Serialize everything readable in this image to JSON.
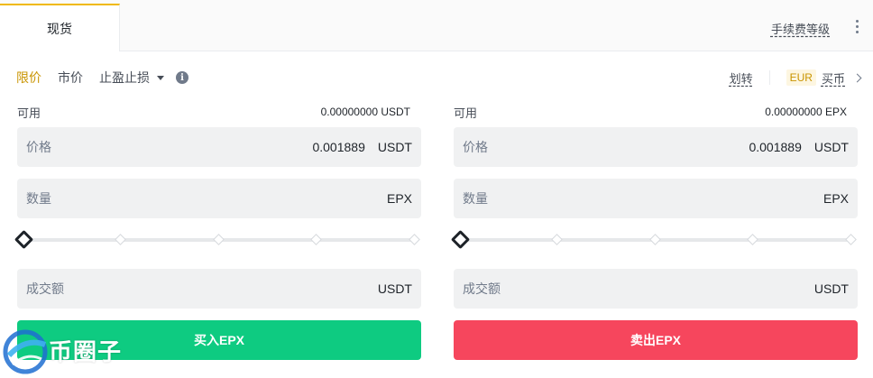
{
  "tabs": {
    "spot": "现货"
  },
  "header": {
    "fee_level": "手续费等级",
    "more_icon": "more-vertical-icon"
  },
  "order_types": {
    "limit": "限价",
    "market": "市价",
    "stop": "止盈止损",
    "info_icon": "info-icon"
  },
  "links": {
    "transfer": "划转",
    "currency": "EUR",
    "buy_crypto": "买币"
  },
  "buy": {
    "available_label": "可用",
    "available_value": "0.00000000 USDT",
    "price_label": "价格",
    "price_value": "0.001889",
    "price_unit": "USDT",
    "amount_label": "数量",
    "amount_unit": "EPX",
    "slider_percent": 0,
    "total_label": "成交额",
    "total_unit": "USDT",
    "button": "买入EPX"
  },
  "sell": {
    "available_label": "可用",
    "available_value": "0.00000000 EPX",
    "price_label": "价格",
    "price_value": "0.001889",
    "price_unit": "USDT",
    "amount_label": "数量",
    "amount_unit": "EPX",
    "slider_percent": 0,
    "total_label": "成交额",
    "total_unit": "USDT",
    "button": "卖出EPX"
  },
  "watermark": {
    "text": "币圈子"
  },
  "colors": {
    "accent": "#f0b90b",
    "buy": "#0ecb81",
    "sell": "#f6465d",
    "field_bg": "#f0f1f2"
  }
}
